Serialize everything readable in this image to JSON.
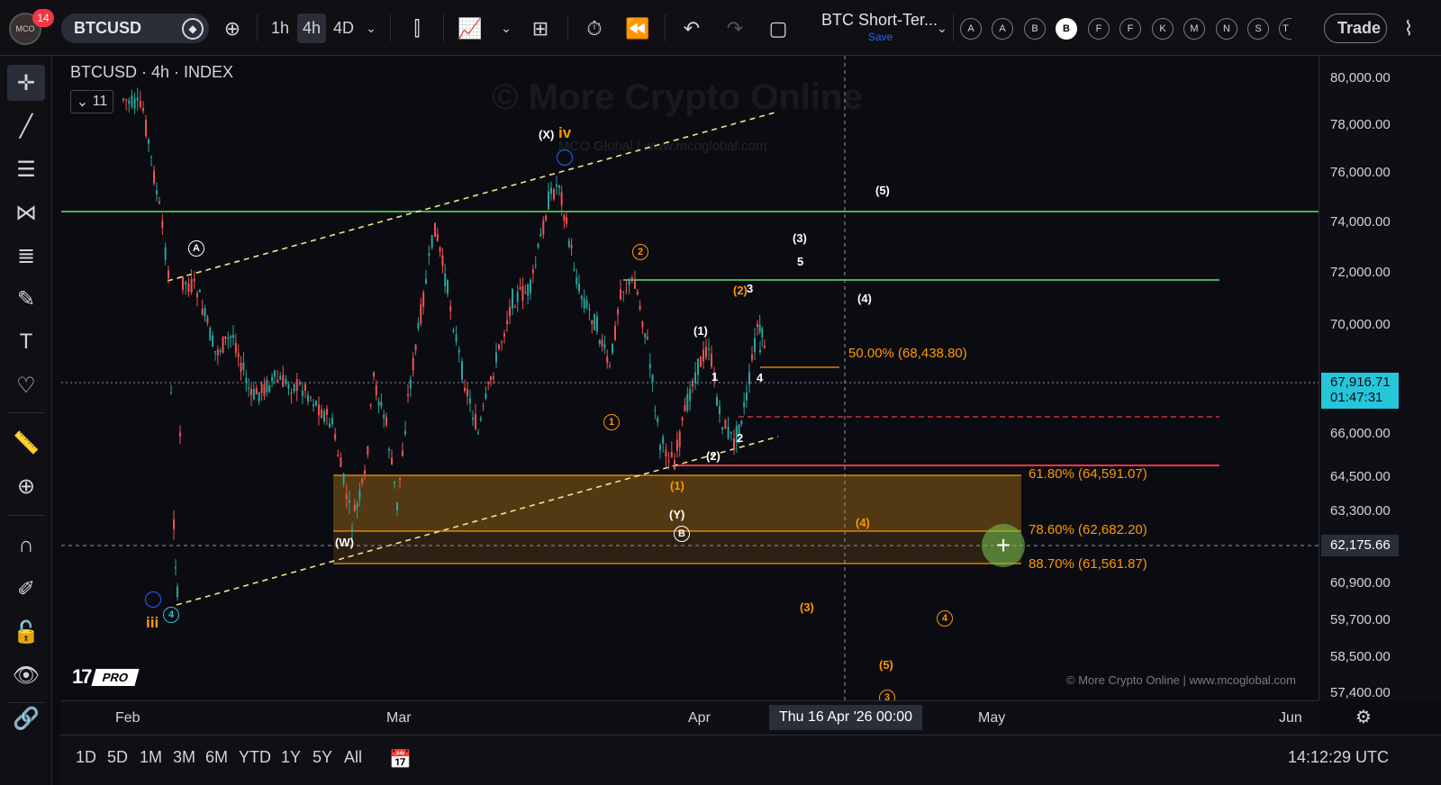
{
  "topbar": {
    "notifications": "14",
    "avatar_text": "MCO",
    "symbol": "BTCUSD",
    "timeframes": [
      "1h",
      "4h",
      "4D"
    ],
    "active_timeframe": "4h",
    "layout_title": "BTC Short-Ter...",
    "layout_save": "Save",
    "alerts": [
      "A",
      "A",
      "B",
      "B",
      "F",
      "F",
      "K",
      "M",
      "N",
      "S",
      "T"
    ],
    "selected_alert_index": 3,
    "trade_label": "Trade"
  },
  "legend": {
    "title": "BTCUSD · 4h · INDEX",
    "toggle_count": "11"
  },
  "watermark": "© More Crypto Online",
  "watermark_url": "MCO Global | www.mcoglobal.com",
  "copyright": "© More Crypto Online  |  www.mcoglobal.com",
  "tv_logo_pro": "PRO",
  "price_axis": {
    "ticks": [
      "80,000.00",
      "78,000.00",
      "76,000.00",
      "74,000.00",
      "72,000.00",
      "70,000.00",
      "66,000.00",
      "64,500.00",
      "63,300.00",
      "60,900.00",
      "59,700.00",
      "58,500.00",
      "57,400.00"
    ],
    "current_price": "67,916.71",
    "countdown": "01:47:31",
    "crosshair_price": "62,175.66"
  },
  "time_axis": {
    "ticks": [
      "Feb",
      "Mar",
      "Apr",
      "May",
      "Jun"
    ],
    "crosshair_time": "Thu 16 Apr '26   00:00"
  },
  "bottombar": {
    "ranges": [
      "1D",
      "5D",
      "1M",
      "3M",
      "6M",
      "YTD",
      "1Y",
      "5Y",
      "All"
    ],
    "clock": "14:12:29 UTC"
  },
  "fib_levels": [
    {
      "label": "50.00% (68,438.80)"
    },
    {
      "label": "61.80% (64,591.07)"
    },
    {
      "label": "78.60% (62,682.20)"
    },
    {
      "label": "88.70% (61,561.87)"
    }
  ],
  "wave_labels": {
    "x_iv_x": "(X)",
    "x_iv_iv": "iv",
    "a": "A",
    "two": "2",
    "three_w": "(3)",
    "five_w": "5",
    "five_top": "(5)",
    "two_3": "(2)",
    "three_small": "3",
    "four_w": "(4)",
    "one_w": "(1)",
    "one_small": "1",
    "one_orange": "1",
    "two_small": "2",
    "two_paren": "(2)",
    "one_paren_orange": "(1)",
    "y": "(Y)",
    "b": "B",
    "w": "(W)",
    "four_orange": "(4)",
    "three_orange": "(3)",
    "four_circ": "4",
    "five_orange": "(5)",
    "three_circ": "3",
    "iii": "iii",
    "four_teal": "4",
    "four_small": "4"
  },
  "colors": {
    "up": "#26a69a",
    "down": "#ef5350",
    "green_line": "#4caf50",
    "red_line": "#f23645",
    "fib": "#ff9800",
    "zone": "#6b4a14",
    "teal": "#26c6da"
  }
}
